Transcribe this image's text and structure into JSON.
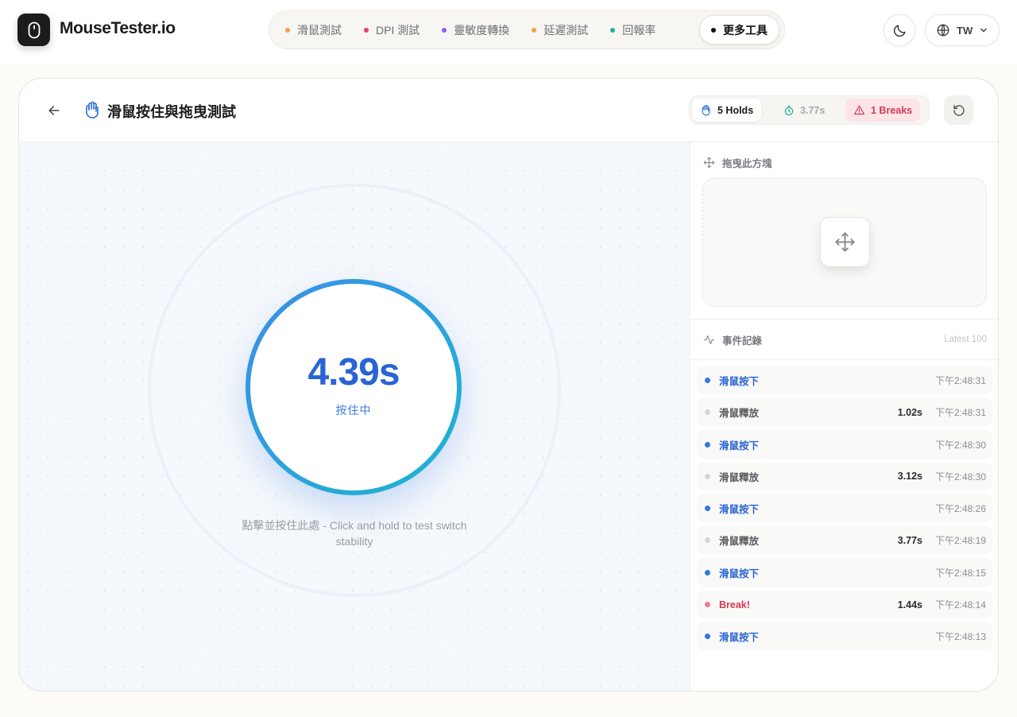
{
  "app": {
    "brand": "MouseTester.io"
  },
  "nav": {
    "items": [
      {
        "label": "滑鼠測試",
        "dot_color": "#f0a04b"
      },
      {
        "label": "DPI 測試",
        "dot_color": "#e5455f"
      },
      {
        "label": "靈敏度轉換",
        "dot_color": "#8b5cf6"
      },
      {
        "label": "延遲測試",
        "dot_color": "#f0a04b"
      },
      {
        "label": "回報率",
        "dot_color": "#16b39a"
      },
      {
        "label": "更多工具",
        "dot_color": "#111111"
      }
    ],
    "active_index": 5
  },
  "header_controls": {
    "language": "TW"
  },
  "test": {
    "title": "滑鼠按住與拖曳測試",
    "stats": {
      "holds": "5 Holds",
      "time": "3.77s",
      "breaks": "1 Breaks"
    },
    "timer": {
      "value": "4.39s",
      "state": "按住中"
    },
    "hint": "點擊並按住此處 - Click and hold to test switch stability"
  },
  "drag": {
    "label": "拖曳此方塊"
  },
  "event_log": {
    "label": "事件記錄",
    "limit_label": "Latest 100",
    "events": [
      {
        "type": "press",
        "label": "滑鼠按下",
        "duration": "",
        "time": "下午2:48:31"
      },
      {
        "type": "release",
        "label": "滑鼠釋放",
        "duration": "1.02s",
        "time": "下午2:48:31"
      },
      {
        "type": "press",
        "label": "滑鼠按下",
        "duration": "",
        "time": "下午2:48:30"
      },
      {
        "type": "release",
        "label": "滑鼠釋放",
        "duration": "3.12s",
        "time": "下午2:48:30"
      },
      {
        "type": "press",
        "label": "滑鼠按下",
        "duration": "",
        "time": "下午2:48:26"
      },
      {
        "type": "release",
        "label": "滑鼠釋放",
        "duration": "3.77s",
        "time": "下午2:48:19"
      },
      {
        "type": "press",
        "label": "滑鼠按下",
        "duration": "",
        "time": "下午2:48:15"
      },
      {
        "type": "break",
        "label": "Break!",
        "duration": "1.44s",
        "time": "下午2:48:14"
      },
      {
        "type": "press",
        "label": "滑鼠按下",
        "duration": "",
        "time": "下午2:48:13"
      }
    ]
  },
  "colors": {
    "accent_blue": "#2a64d4",
    "break_red": "#d23a55",
    "timer_gradient_start": "#3b8ee6",
    "timer_gradient_end": "#1eb5cf"
  }
}
